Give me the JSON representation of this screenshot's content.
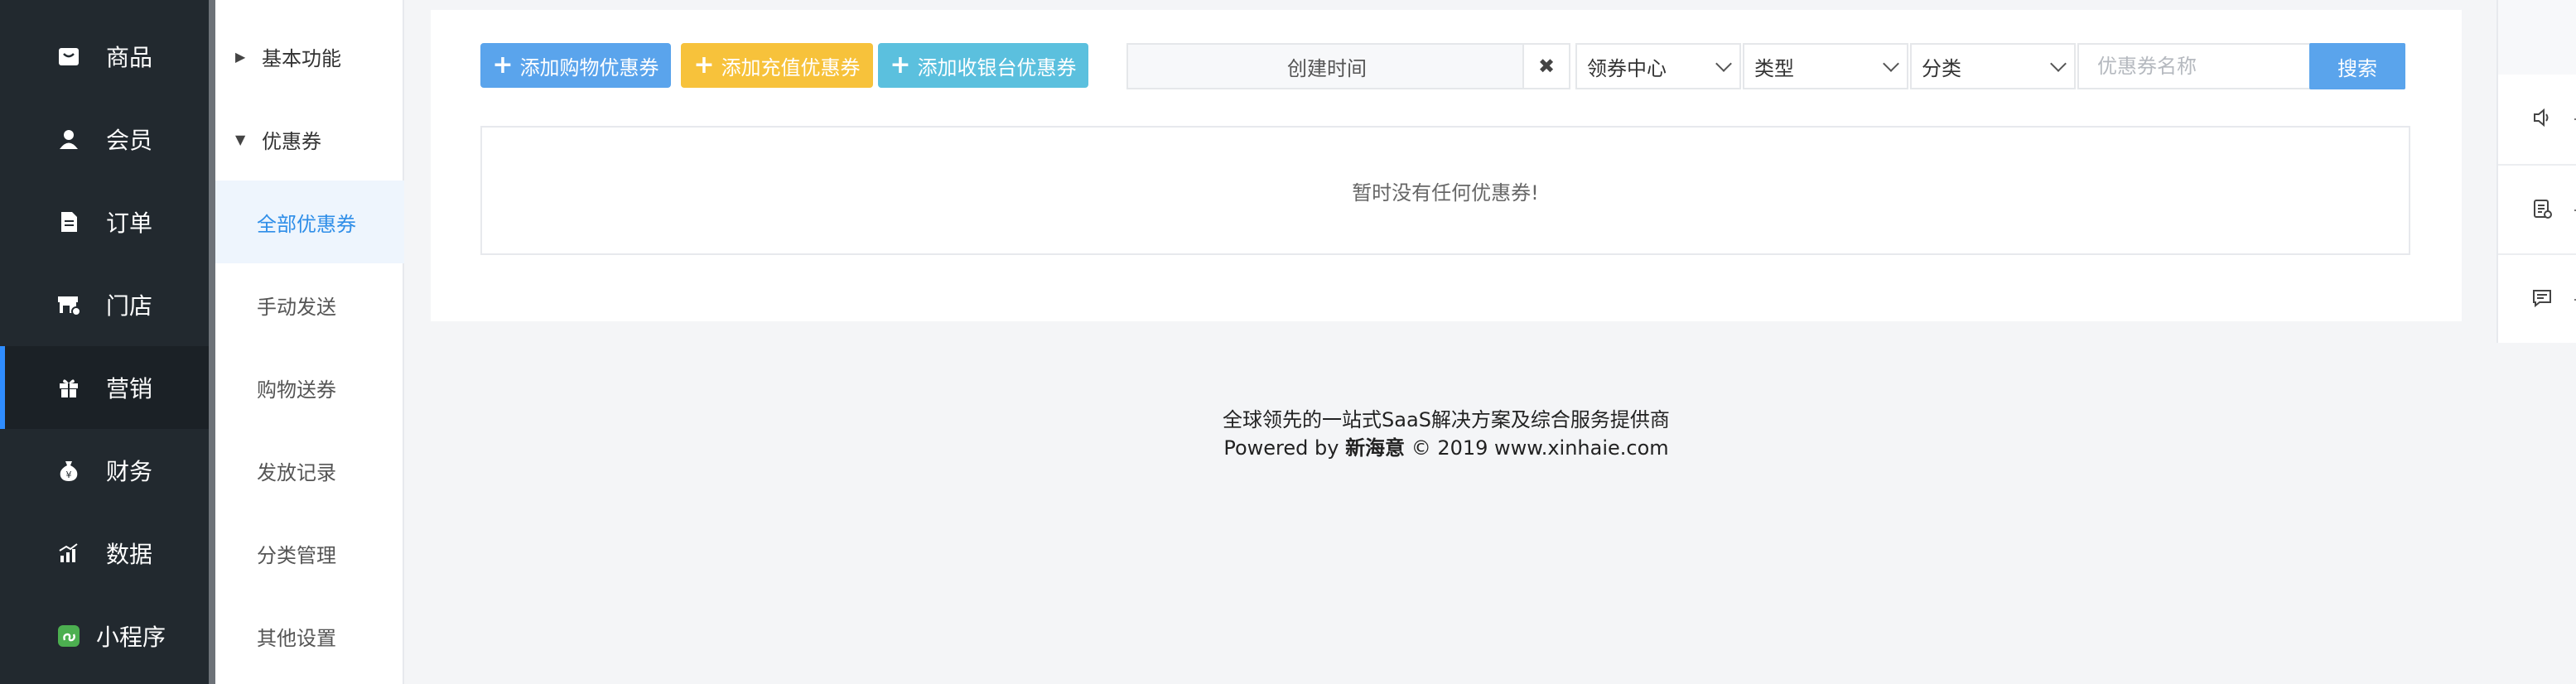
{
  "nav": {
    "items": [
      {
        "label": "商品",
        "icon": "box-icon"
      },
      {
        "label": "会员",
        "icon": "user-icon"
      },
      {
        "label": "订单",
        "icon": "document-icon"
      },
      {
        "label": "门店",
        "icon": "store-icon"
      },
      {
        "label": "营销",
        "icon": "gift-icon",
        "active": true
      },
      {
        "label": "财务",
        "icon": "money-bag-icon"
      },
      {
        "label": "数据",
        "icon": "bar-chart-icon"
      },
      {
        "label": "小程序",
        "icon": "mini-program-icon"
      }
    ]
  },
  "submenu": {
    "group_basic": "基本功能",
    "group_coupon": "优惠券",
    "items": [
      "全部优惠券",
      "手动发送",
      "购物送券",
      "发放记录",
      "分类管理",
      "其他设置"
    ],
    "active_index": 0
  },
  "toolbar": {
    "add_shopping": "添加购物优惠券",
    "add_recharge": "添加充值优惠券",
    "add_cashier": "添加收银台优惠券",
    "date_placeholder": "创建时间",
    "clear_glyph": "✖",
    "select_center": "领券中心",
    "select_type": "类型",
    "select_category": "分类",
    "name_placeholder": "优惠券名称",
    "search_label": "搜索"
  },
  "empty_message": "暂时没有任何优惠券!",
  "footer": {
    "line1": "全球领先的一站式SaaS解决方案及综合服务提供商",
    "line2_prefix": "Powered by ",
    "brand": "新海意",
    "line2_suffix": " © 2019 www.xinhaie.com"
  },
  "colors": {
    "nav_bg": "#22292f",
    "accent_blue": "#5aa4ec",
    "accent_yellow": "#f7c23b",
    "accent_cyan": "#5bc0de",
    "active_submenu_text": "#2f8ee8"
  }
}
